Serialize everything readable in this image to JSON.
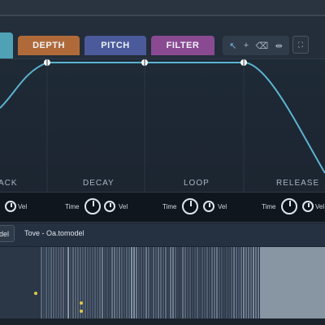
{
  "tabs": {
    "attack": {
      "label": "",
      "color": "#4fa2b6"
    },
    "depth": {
      "label": "DEPTH",
      "color": "#b06a3a"
    },
    "pitch": {
      "label": "PITCH",
      "color": "#4a5a9a"
    },
    "filter": {
      "label": "FILTER",
      "color": "#8a4a92"
    }
  },
  "tools": {
    "pointer_icon": "cursor-arrow-icon",
    "add_icon": "plus-icon",
    "erase_icon": "eraser-icon",
    "stretch_icon": "stretch-icon",
    "zoom_fit_icon": "zoom-fit-icon"
  },
  "envelope": {
    "stages": {
      "attack": "ACK",
      "decay": "DECAY",
      "loop": "LOOP",
      "release": "RELEASE"
    },
    "curve_color": "#5ab4cf"
  },
  "knobs": {
    "attack": {
      "vel_label": "Vel"
    },
    "decay": {
      "time_label": "Time",
      "vel_label": "Vel"
    },
    "loop": {
      "time_label": "Time",
      "vel_label": "Vel"
    },
    "release": {
      "time_label": "Time",
      "vel_label": "Vel"
    }
  },
  "filebar": {
    "left_label": "del",
    "file_name": "Tove - Oa.tomodel"
  }
}
